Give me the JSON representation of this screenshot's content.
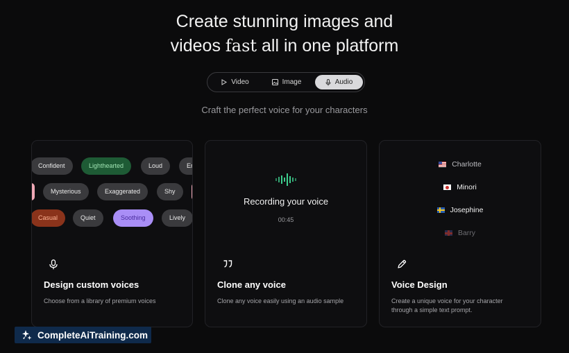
{
  "hero": {
    "title_line1": "Create stunning images and",
    "title_line2_pre": "videos ",
    "title_line2_fast": "fast",
    "title_line2_post": " all in one platform"
  },
  "tabs": [
    {
      "label": "Video",
      "icon": "play-icon"
    },
    {
      "label": "Image",
      "icon": "image-icon"
    },
    {
      "label": "Audio",
      "icon": "microphone-icon",
      "active": true
    }
  ],
  "subtitle": "Craft the perfect voice for your characters",
  "cards": {
    "custom": {
      "chips_row1": [
        "Confident",
        "Lighthearted",
        "Loud",
        "En"
      ],
      "chips_row2": [
        "Mysterious",
        "Exaggerated",
        "Shy"
      ],
      "chips_row3": [
        "Casual",
        "Quiet",
        "Soothing",
        "Lively"
      ],
      "icon": "microphone-icon",
      "title": "Design custom voices",
      "desc": "Choose from a library of premium voices"
    },
    "clone": {
      "recording_label": "Recording your voice",
      "timer": "00:45",
      "icon": "quote-icon",
      "title": "Clone any voice",
      "desc": "Clone any voice easily using an audio sample"
    },
    "design": {
      "names": [
        {
          "name": "Charlotte",
          "flag": "us-flag-icon"
        },
        {
          "name": "Minori",
          "flag": "japan-flag-icon"
        },
        {
          "name": "Josephine",
          "flag": "sweden-flag-icon"
        },
        {
          "name": "Barry",
          "flag": "uk-flag-icon"
        }
      ],
      "icon": "pen-icon",
      "title": "Voice Design",
      "desc_line1": "Create a unique voice for your character",
      "desc_line2": "through a simple text prompt."
    }
  },
  "watermark": {
    "text": "CompleteAiTraining.com",
    "icon": "sparkle-logo-icon"
  },
  "colors": {
    "background": "#0b0b0c",
    "accent_green": "#3ecf8e",
    "accent_purple": "#a98ef6"
  }
}
